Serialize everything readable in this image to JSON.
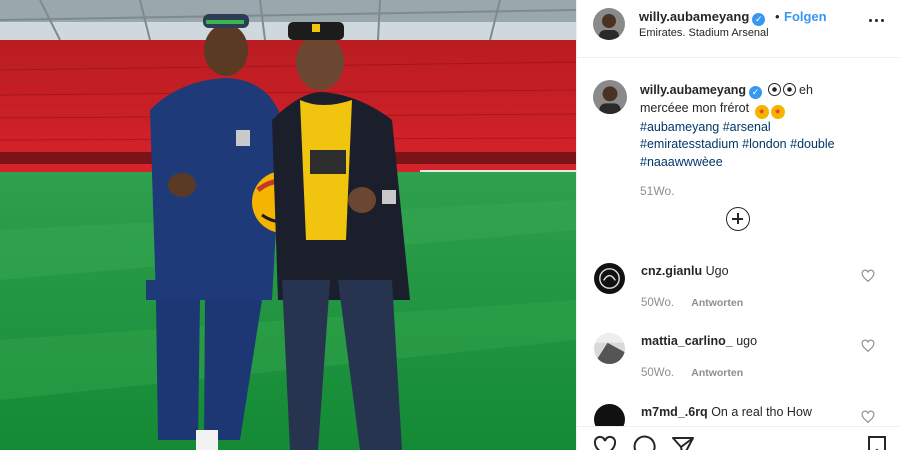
{
  "colors": {
    "accent": "#3897f0",
    "text": "#262626",
    "muted": "#8e8e8e",
    "hashtag": "#00376b",
    "border": "#efefef"
  },
  "photo": {
    "description_icon": "photo"
  },
  "header": {
    "username": "willy.aubameyang",
    "verified_icon": "verified-badge-icon",
    "separator": "•",
    "follow_label": "Folgen",
    "location": "Emirates. Stadium Arsenal",
    "more_icon": "more-options-icon"
  },
  "caption": {
    "username": "willy.aubameyang",
    "text_line1": "eh",
    "text_line2": "mercéee mon frérot",
    "hashtags": [
      "#aubameyang",
      "#arsenal",
      "#emiratesstadium",
      "#london",
      "#double",
      "#naaawwwèee"
    ],
    "time": "51Wo."
  },
  "load_more_icon": "plus-circle-icon",
  "comments": [
    {
      "username": "cnz.gianlu",
      "text": "Ugo",
      "time": "50Wo.",
      "reply": "Antworten"
    },
    {
      "username": "mattia_carlino_",
      "text": "ugo",
      "time": "50Wo.",
      "reply": "Antworten"
    },
    {
      "username": "m7md_.6rq",
      "text": "On a real tho How",
      "time": "",
      "reply": ""
    }
  ],
  "actions": {
    "like_icon": "heart-icon",
    "comment_icon": "comment-icon",
    "share_icon": "share-icon",
    "save_icon": "bookmark-icon"
  }
}
